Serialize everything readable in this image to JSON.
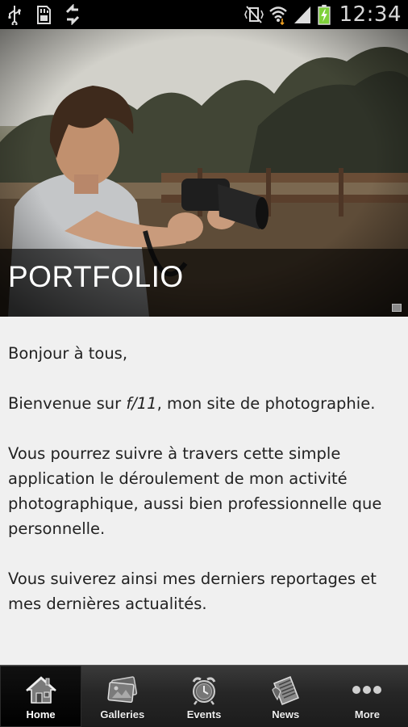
{
  "status_bar": {
    "time": "12:34",
    "left_icons": [
      "usb-icon",
      "sd-card-icon",
      "sync-icon"
    ],
    "right_icons": [
      "vibrate-icon",
      "wifi-icon",
      "signal-icon",
      "battery-charging-icon"
    ]
  },
  "hero": {
    "title": "PORTFOLIO"
  },
  "content": {
    "greeting": "Bonjour à tous,",
    "welcome_prefix": "Bienvenue sur ",
    "welcome_site": "f/11",
    "welcome_suffix": ", mon site de photographie.",
    "paragraph_2": "Vous pourrez suivre à travers cette simple application le déroulement de mon activité photographique, aussi bien professionnelle que personnelle.",
    "paragraph_3": "Vous suiverez ainsi mes derniers reportages et mes dernières actualités."
  },
  "tabs": [
    {
      "label": "Home",
      "icon": "house-icon",
      "active": true
    },
    {
      "label": "Galleries",
      "icon": "photos-icon",
      "active": false
    },
    {
      "label": "Events",
      "icon": "alarm-clock-icon",
      "active": false
    },
    {
      "label": "News",
      "icon": "newspaper-icon",
      "active": false
    },
    {
      "label": "More",
      "icon": "more-dots-icon",
      "active": false
    }
  ],
  "colors": {
    "content_bg": "#f0f0f0",
    "tab_bar_bg": "#262626",
    "battery_green": "#7fd13b"
  }
}
